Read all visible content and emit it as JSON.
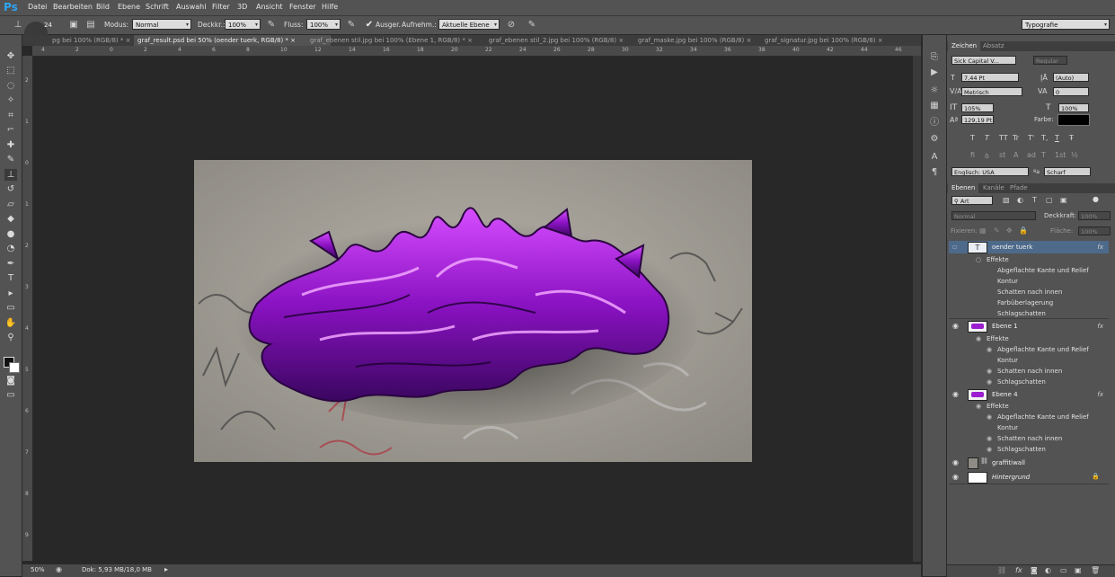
{
  "app": {
    "logo": "Ps"
  },
  "menu": [
    "Datei",
    "Bearbeiten",
    "Bild",
    "Ebene",
    "Schrift",
    "Auswahl",
    "Filter",
    "3D",
    "Ansicht",
    "Fenster",
    "Hilfe"
  ],
  "options": {
    "brush_size": "24",
    "modus_label": "Modus:",
    "modus_value": "Normal",
    "deckkr_label": "Deckkr.:",
    "deckkr_value": "100%",
    "fluss_label": "Fluss:",
    "fluss_value": "100%",
    "ausger_label": "Ausger.",
    "aufnehm_label": "Aufnehm.:",
    "aufnehm_value": "Aktuelle Ebene",
    "workspace": "Typografie"
  },
  "tabs": [
    "pg bei 100% (RGB/8) *",
    "graf_result.psd bei 50% (oender tuerk, RGB/8) *",
    "graf_ebenen stil.jpg bei 100% (Ebene 1, RGB/8) *",
    "graf_ebenen stil_2.jpg bei 100% (RGB/8)",
    "graf_maske.jpg bei 100% (RGB/8)",
    "graf_signatur.jpg bei 100% (RGB/8)"
  ],
  "tab_close": "×",
  "ruler_top": [
    "4",
    "2",
    "0",
    "2",
    "4",
    "6",
    "8",
    "10",
    "12",
    "14",
    "16",
    "18",
    "20",
    "22",
    "24",
    "26",
    "28",
    "30",
    "32",
    "34",
    "36",
    "38",
    "40",
    "42",
    "44",
    "46"
  ],
  "ruler_left": [
    "2",
    "1",
    "0",
    "1",
    "2",
    "3",
    "4",
    "5",
    "6",
    "7",
    "8",
    "9"
  ],
  "status": {
    "zoom": "50%",
    "doc": "Dok: 5,93 MB/18,0 MB"
  },
  "character": {
    "tab_zeichen": "Zeichen",
    "tab_absatz": "Absatz",
    "font_family": "Sick Capital V...",
    "font_style": "Regular",
    "size": "7,44 Pt",
    "leading": "(Auto)",
    "kerning": "Metrisch",
    "tracking": "0",
    "vscale": "105%",
    "hscale": "100%",
    "baseline": "129,19 Pt",
    "farbe_label": "Farbe:",
    "language": "Englisch: USA",
    "aa_label": "ªa",
    "antialias": "Scharf",
    "style_glyphs": [
      "T",
      "T",
      "TT",
      "Tr",
      "T'",
      "T,",
      "T",
      "Ŧ"
    ],
    "ot_glyphs": [
      "fi",
      "ꝺ",
      "st",
      "A",
      "ad",
      "T",
      "1st",
      "½"
    ]
  },
  "layers": {
    "tab_ebenen": "Ebenen",
    "tab_kanaele": "Kanäle",
    "tab_pfade": "Pfade",
    "filter_kind": "Art",
    "blend": "Normal",
    "opacity_label": "Deckkraft:",
    "opacity_value": "100%",
    "lock_label": "Fixieren:",
    "fill_label": "Fläche:",
    "fill_value": "100%",
    "items": [
      {
        "name": "oender tuerk",
        "kind": "text",
        "fx": "fx",
        "effects_title": "Effekte",
        "effects": [
          "Abgeflachte Kante und Relief",
          "Kontur",
          "Schatten nach innen",
          "Farbüberlagerung",
          "Schlagschatten"
        ]
      },
      {
        "name": "Ebene 1",
        "kind": "pixel",
        "fx": "fx",
        "effects_title": "Effekte",
        "effects": [
          "Abgeflachte Kante und Relief",
          "Kontur",
          "Schatten nach innen",
          "Schlagschatten"
        ]
      },
      {
        "name": "Ebene 4",
        "kind": "pixel",
        "fx": "fx",
        "effects_title": "Effekte",
        "effects": [
          "Abgeflachte Kante und Relief",
          "Kontur",
          "Schatten nach innen",
          "Schlagschatten"
        ]
      },
      {
        "name": "graffitiwall",
        "kind": "image",
        "fx": "",
        "effects_title": "",
        "effects": []
      },
      {
        "name": "Hintergrund",
        "kind": "background",
        "fx": "",
        "effects_title": "",
        "effects": []
      }
    ]
  },
  "colors": {
    "accent": "#2fa3f2",
    "selected_layer": "#4d6a8b",
    "graffiti": "#9b1fd0"
  }
}
